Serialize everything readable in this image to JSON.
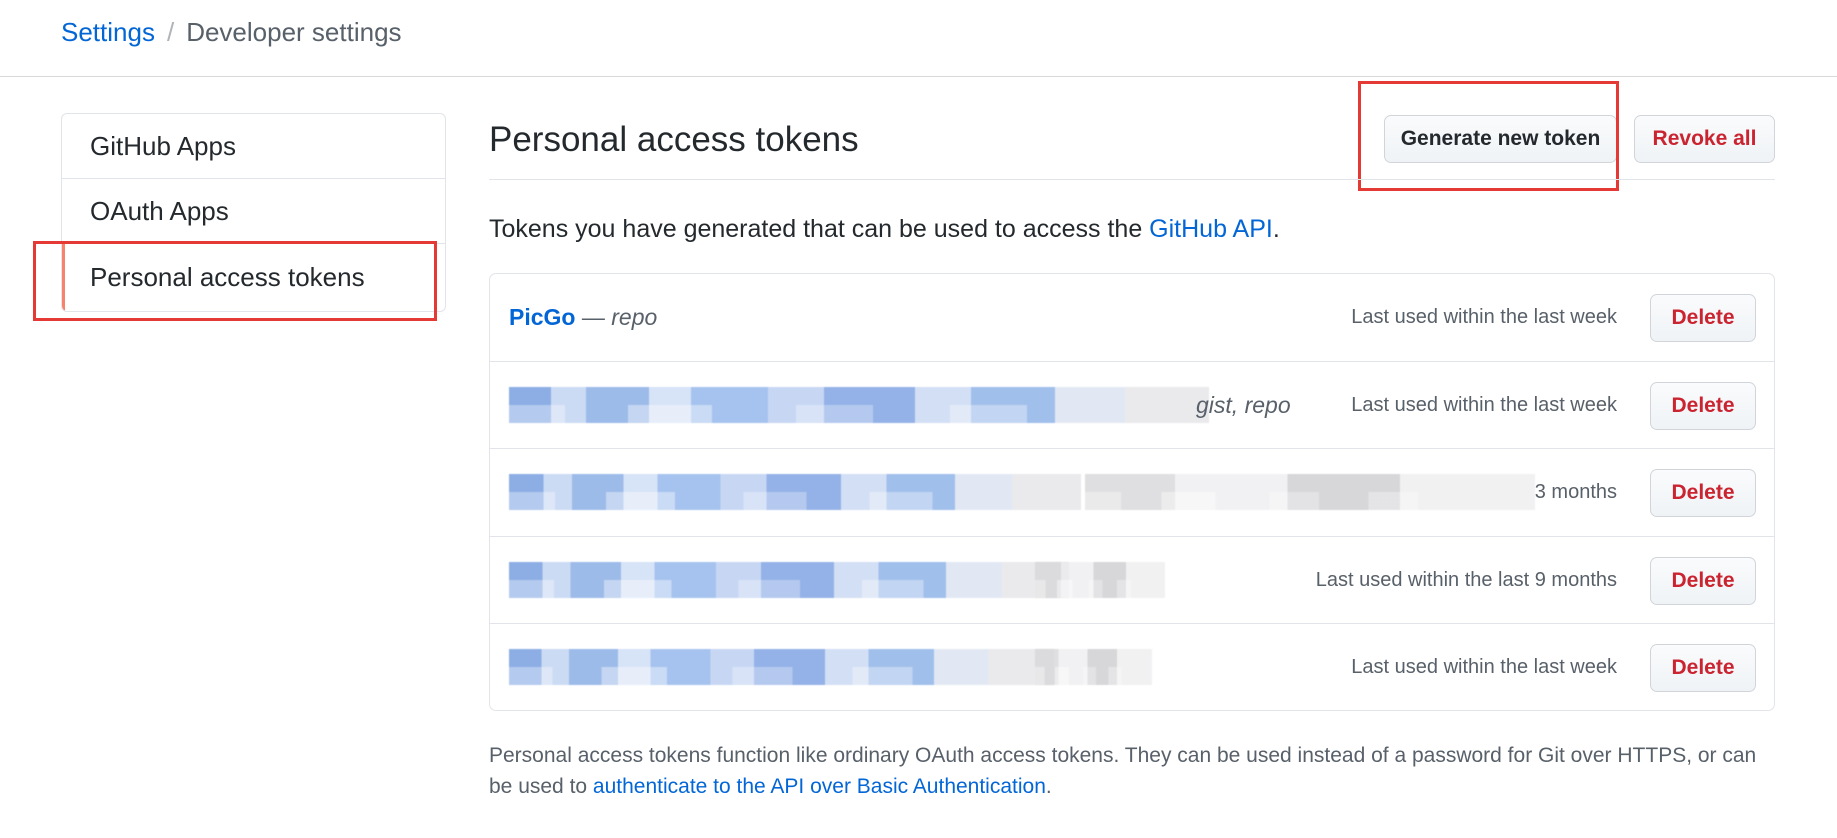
{
  "breadcrumb": {
    "root": "Settings",
    "separator": "/",
    "current": "Developer settings"
  },
  "sidebar": {
    "items": [
      {
        "label": "GitHub Apps"
      },
      {
        "label": "OAuth Apps"
      },
      {
        "label": "Personal access tokens",
        "selected": true
      }
    ],
    "selected_accent": "#f9826c"
  },
  "main": {
    "title": "Personal access tokens",
    "generate_button": "Generate new token",
    "revoke_button": "Revoke all",
    "intro_prefix": "Tokens you have generated that can be used to access the ",
    "intro_link": "GitHub API",
    "intro_suffix": "."
  },
  "tokens": [
    {
      "name": "PicGo",
      "dash": "—",
      "scopes": "repo",
      "last_used": "Last used within the last week",
      "delete_label": "Delete",
      "redacted": false
    },
    {
      "name": "",
      "scopes": "gist, repo",
      "last_used": "Last used within the last week",
      "delete_label": "Delete",
      "redacted": true
    },
    {
      "name": "",
      "scopes": "",
      "last_used": "3 months",
      "delete_label": "Delete",
      "redacted": true
    },
    {
      "name": "",
      "scopes": "",
      "last_used": "Last used within the last 9 months",
      "delete_label": "Delete",
      "redacted": true
    },
    {
      "name": "",
      "scopes": "",
      "last_used": "Last used within the last week",
      "delete_label": "Delete",
      "redacted": true
    }
  ],
  "footnote": {
    "text": "Personal access tokens function like ordinary OAuth access tokens. They can be used instead of a password for Git over HTTPS, or can be used to ",
    "link": "authenticate to the API over Basic Authentication",
    "suffix": "."
  },
  "colors": {
    "link": "#0366d6",
    "danger": "#cb2431",
    "annotation_box": "#e53935"
  }
}
